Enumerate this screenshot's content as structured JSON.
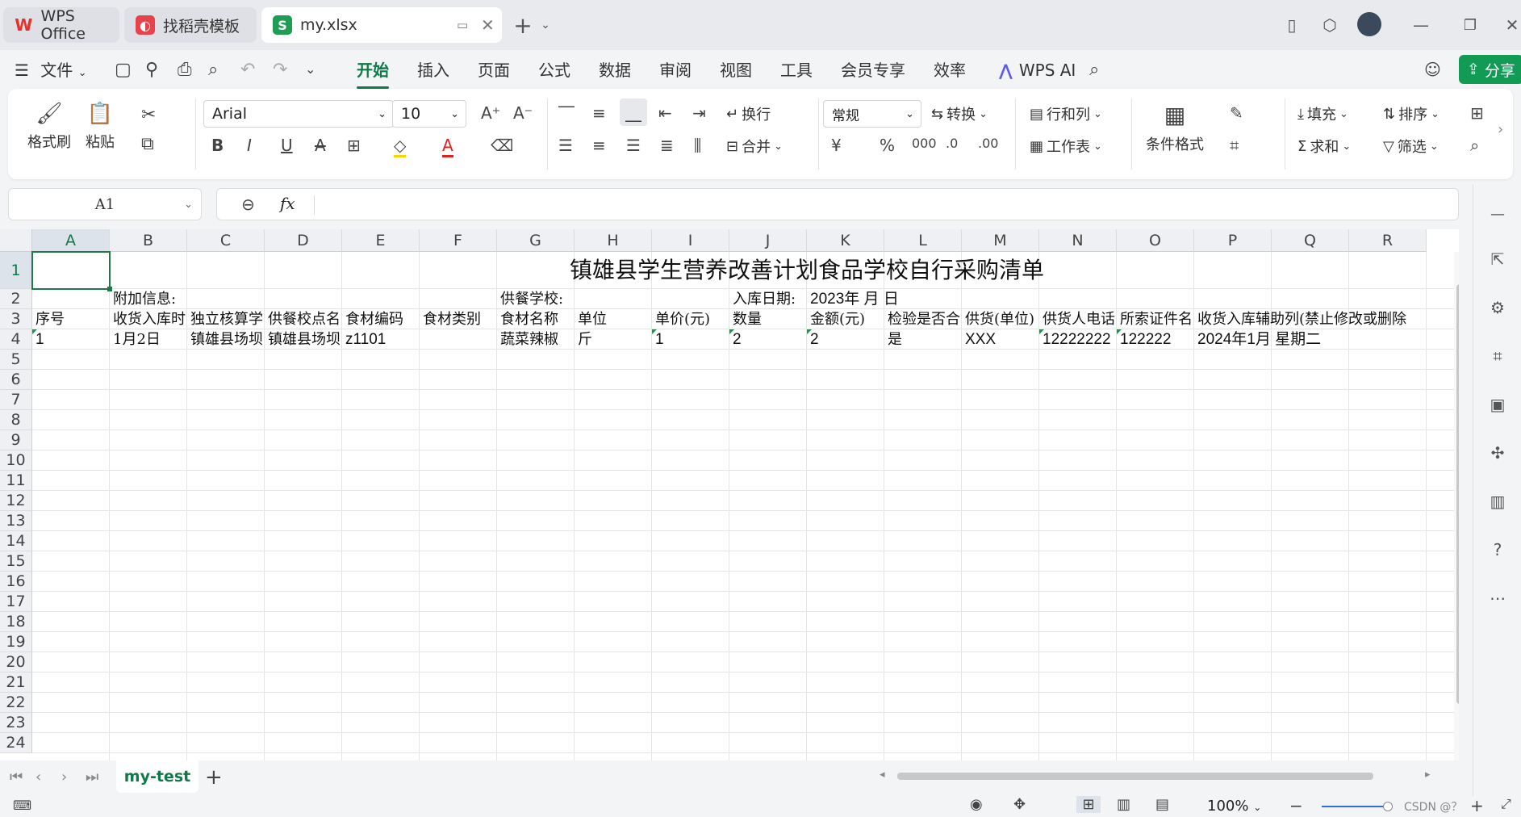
{
  "tabs": [
    {
      "label": "WPS Office",
      "icon": "wps-logo-icon"
    },
    {
      "label": "找稻壳模板",
      "icon": "docer-icon"
    },
    {
      "label": "my.xlsx",
      "icon": "spreadsheet-s-icon"
    }
  ],
  "menu": {
    "file": "文件",
    "items": [
      "开始",
      "插入",
      "页面",
      "公式",
      "数据",
      "审阅",
      "视图",
      "工具",
      "会员专享",
      "效率"
    ],
    "ai": "WPS AI",
    "share": "分享"
  },
  "ribbon": {
    "format_painter": "格式刷",
    "paste": "粘贴",
    "font": "Arial",
    "size": "10",
    "wrap": "换行",
    "merge": "合并",
    "number_format": "常规",
    "convert": "转换",
    "rows_cols": "行和列",
    "worksheet": "工作表",
    "cond_format": "条件格式",
    "fill": "填充",
    "sort": "排序",
    "sum": "求和",
    "filter": "筛选"
  },
  "namebox": "A1",
  "fx": "fx",
  "columns": [
    "A",
    "B",
    "C",
    "D",
    "E",
    "F",
    "G",
    "H",
    "I",
    "J",
    "K",
    "L",
    "M",
    "N",
    "O",
    "P",
    "Q",
    "R"
  ],
  "rows": [
    "1",
    "2",
    "3",
    "4",
    "5",
    "6",
    "7",
    "8",
    "9",
    "10",
    "11",
    "12",
    "13",
    "14",
    "15",
    "16",
    "17",
    "18",
    "19",
    "20",
    "21",
    "22",
    "23",
    "24"
  ],
  "sheet": {
    "title": "镇雄县学生营养改善计划食品学校自行采购清单",
    "row2": {
      "b": "附加信息:",
      "g": "供餐学校:",
      "j": "入库日期:",
      "k": "2023年 月 日"
    },
    "headers": [
      "序号",
      "收货入库时",
      "独立核算学",
      "供餐校点名",
      "食材编码",
      "食材类别",
      "食材名称",
      "单位",
      "单价(元)",
      "数量",
      "金额(元)",
      "检验是否合",
      "供货(单位)",
      "供货人电话",
      "所索证件名",
      "收货入库辅助列(禁止修改或删除"
    ],
    "row4": [
      "1",
      "1月2日",
      "镇雄县场坝",
      "镇雄县场坝",
      "z1101",
      "",
      "蔬菜辣椒",
      "斤",
      "1",
      "2",
      "2",
      "是",
      "XXX",
      "12222222",
      "122222",
      "2024年1月 星期二"
    ]
  },
  "sheet_tab": "my-test",
  "zoom": "100%",
  "watermark": "CSDN @？"
}
